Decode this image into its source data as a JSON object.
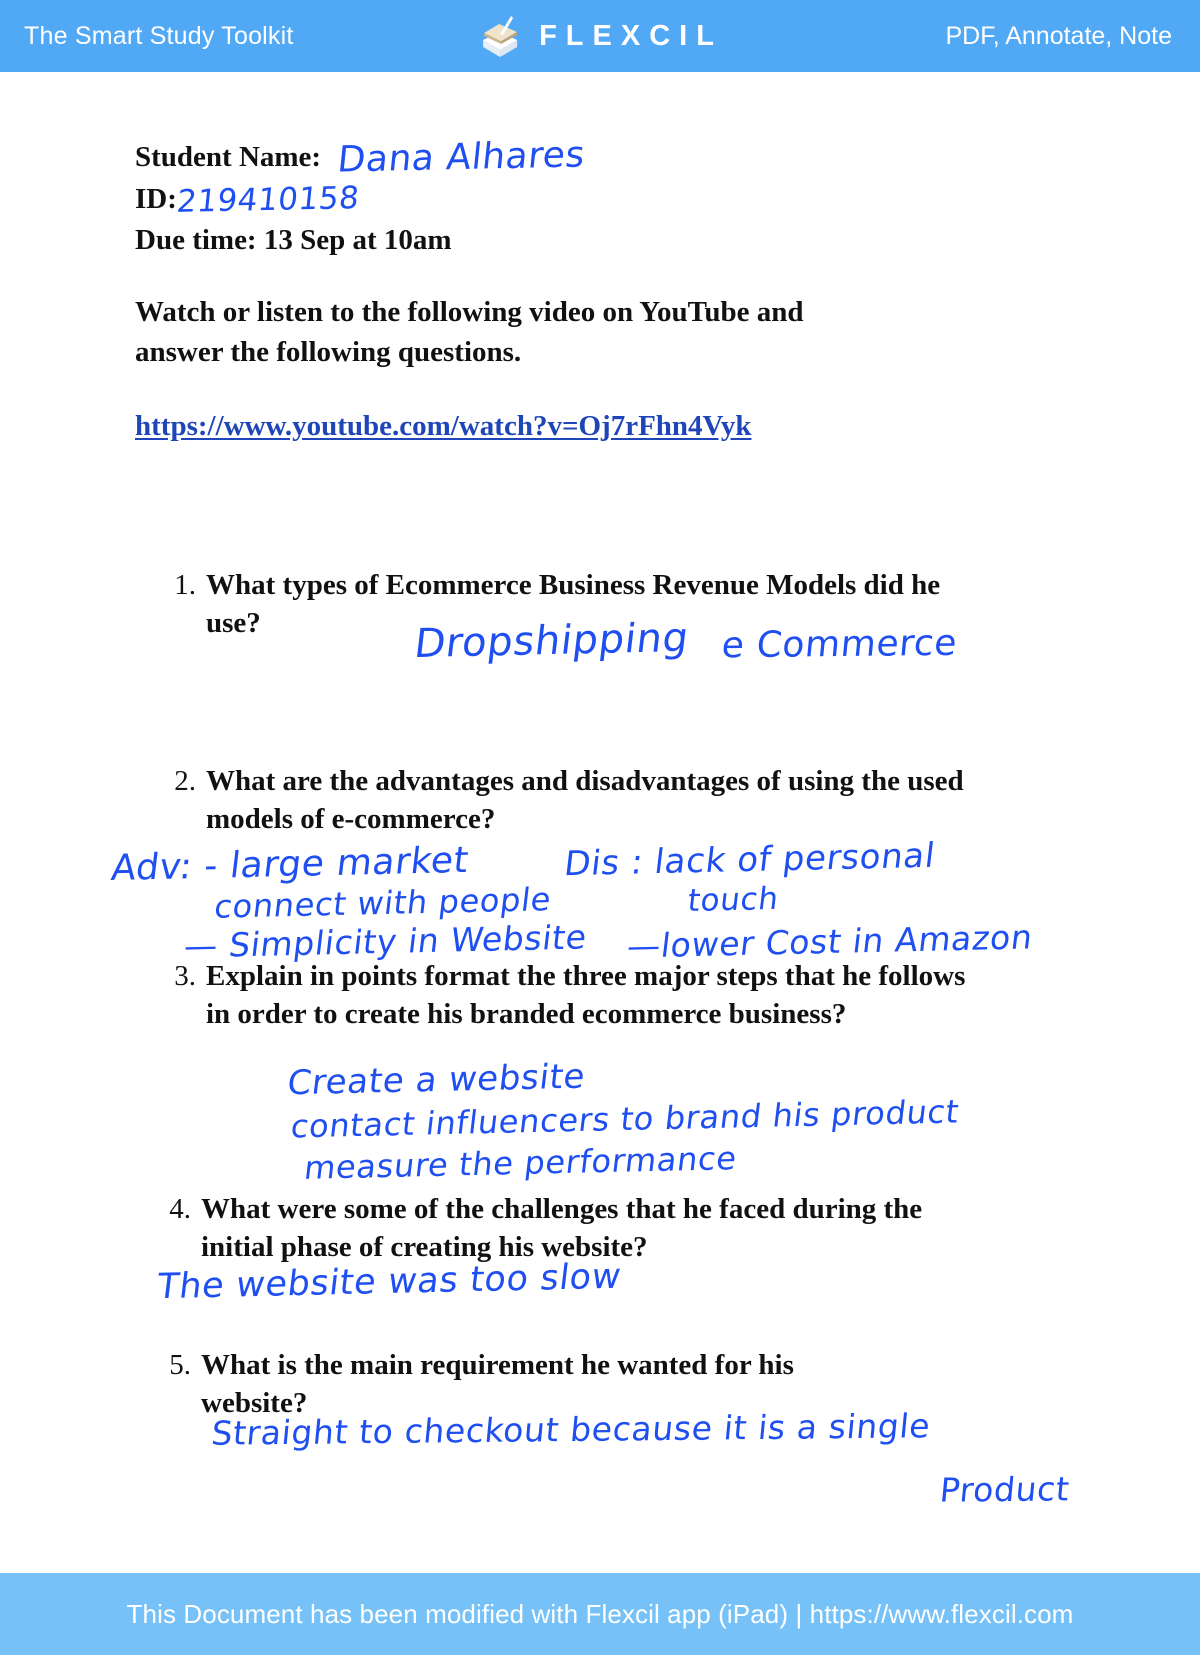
{
  "header": {
    "left_tagline": "The Smart Study Toolkit",
    "brand": "FLEXCIL",
    "logo_icon": "book-pen-icon",
    "right_tagline": "PDF, Annotate, Note",
    "bar_color": "#51a9f6"
  },
  "footer": {
    "text": "This Document has been modified with Flexcil app (iPad) | https://www.flexcil.com",
    "bar_color": "#76c2f8"
  },
  "document": {
    "student_name_label": "Student Name:",
    "student_name_value": "Dana Alhares",
    "id_label": "ID:",
    "id_value": "219410158",
    "due_time": "Due time: 13 Sep at 10am",
    "instruction_line1": "Watch or listen to the following video on YouTube and",
    "instruction_line2": "answer the following questions.",
    "video_url": "https://www.youtube.com/watch?v=Oj7rFhn4Vyk",
    "ink_color": "#1f4ff0",
    "questions": [
      {
        "number": "1.",
        "text": "What types of Ecommerce Business Revenue Models did he use?",
        "answers": [
          "Dropshipping",
          "e Commerce"
        ]
      },
      {
        "number": "2.",
        "text": "What are the advantages and disadvantages of using the used models of e-commerce?",
        "answers": [
          "Adv: - large market",
          "connect with people",
          "— Simplicity in Website",
          "Dis : lack of personal",
          "touch",
          "—lower Cost in Amazon"
        ]
      },
      {
        "number": "3.",
        "text": "Explain in points format the three major steps that he follows in order to create his branded ecommerce business?",
        "answers": [
          "Create a website",
          "contact influencers to brand his product",
          "measure the performance"
        ]
      },
      {
        "number": "4.",
        "text": "What were some of the challenges that he faced during the initial phase of creating his website?",
        "answers": [
          "The website was too slow"
        ]
      },
      {
        "number": "5.",
        "text": "What is the main requirement he wanted for his website?",
        "answers": [
          "Straight to checkout because it is a   single",
          "Product"
        ]
      }
    ]
  }
}
